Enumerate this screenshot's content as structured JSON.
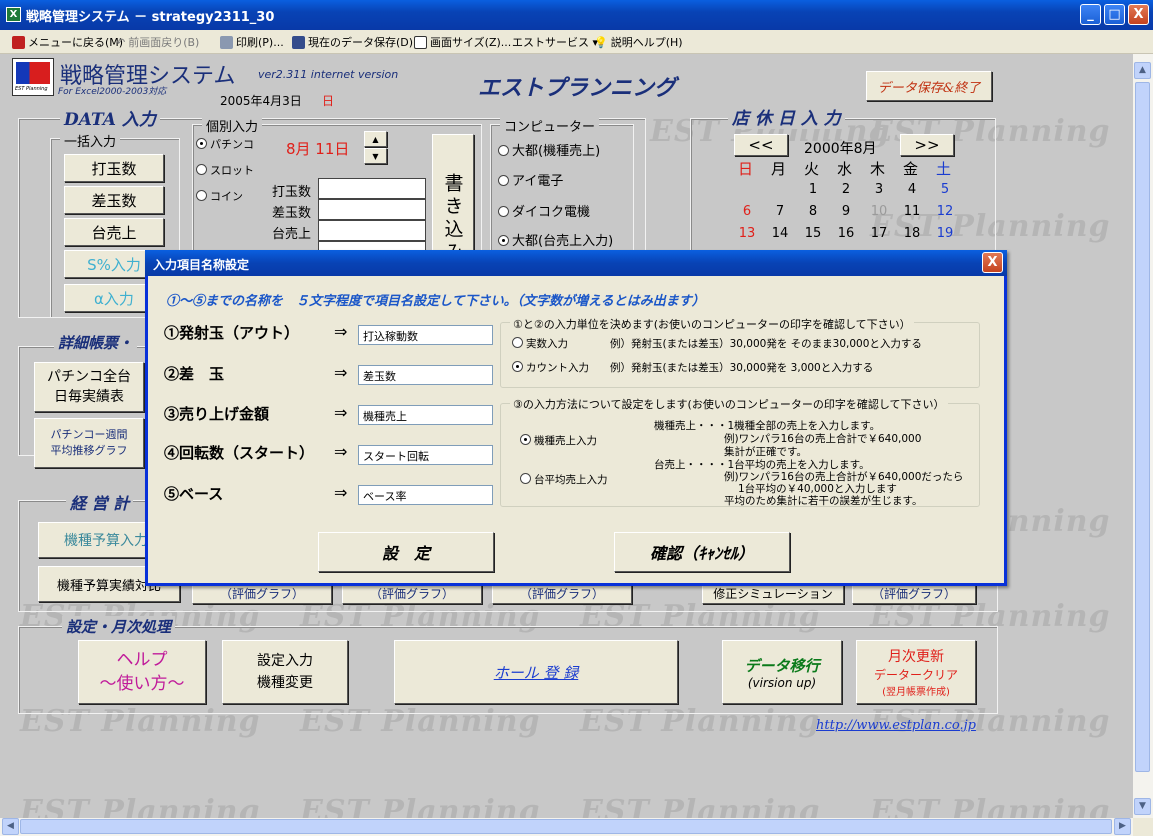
{
  "window": {
    "title": "戦略管理システム － strategy2311_30",
    "icon": "excel-icon",
    "min": "_",
    "max": "□",
    "close": "X"
  },
  "toolbar": {
    "items": [
      "メニューに戻る(M)",
      "前画面戻り(B)",
      "印刷(P)...",
      "現在のデータ保存(D)",
      "画面サイズ(Z)...",
      "エストサービス ▾",
      "説明ヘルプ(H)"
    ]
  },
  "header": {
    "system_title": "戦略管理システム",
    "version": "ver2.311 internet version",
    "excel_note": "For Excel2000-2003対応",
    "date": "2005年4月3日",
    "weekday": "日",
    "company": "エストプランニング",
    "save_exit": "データ保存&終了",
    "logo_text": "EST Planning"
  },
  "watermark": "EST Planning",
  "data_input": {
    "heading": "DATA 入力",
    "bulk_label": "一括入力",
    "bulk_buttons": [
      "打玉数",
      "差玉数",
      "台売上",
      "S%入力",
      "α入力"
    ],
    "indiv_label": "個別入力",
    "game_types": [
      "パチンコ",
      "スロット",
      "コイン"
    ],
    "selected_game": "パチンコ",
    "date_value": "8月 11日",
    "fields": [
      "打玉数",
      "差玉数",
      "台売上"
    ],
    "write_button": "書き込み",
    "computer_label": "コンピューター",
    "computers": [
      "大都(機種売上)",
      "アイ電子",
      "ダイコク電機",
      "大都(台売上入力)"
    ],
    "selected_computer": "大都(台売上入力)"
  },
  "holiday": {
    "heading": "店 休 日 入 力",
    "prev": "<<",
    "next": ">>",
    "month": "2000年8月",
    "weekdays": [
      "日",
      "月",
      "火",
      "水",
      "木",
      "金",
      "土"
    ],
    "rows": [
      [
        "",
        "",
        "1",
        "2",
        "3",
        "4",
        "5"
      ],
      [
        "6",
        "7",
        "8",
        "9",
        "10",
        "11",
        "12"
      ],
      [
        "13",
        "14",
        "15",
        "16",
        "17",
        "18",
        "19"
      ]
    ]
  },
  "detail": {
    "heading": "詳細帳票・",
    "btn1": "パチンコ全台\n日毎実績表",
    "btn2": "パチンコー週間\n平均推移グラフ"
  },
  "plan": {
    "heading": "経 営 計",
    "btn1": "機種予算入力",
    "btn2": "機種予算実績対比",
    "graph": "（評価グラフ）",
    "sim": "修正シミュレーション"
  },
  "settings": {
    "heading": "設定・月次処理",
    "help": "ヘルプ\n～使い方～",
    "setting": "設定入力\n機種変更",
    "hall": "ホール 登 録",
    "migrate": "データ移行",
    "migrate_sub": "(virsion up)",
    "monthly1": "月次更新",
    "monthly2": "データークリア",
    "monthly3": "(翌月帳票作成)",
    "url": "http://www.estplan.co.jp"
  },
  "dialog": {
    "title": "入力項目名称設定",
    "close": "X",
    "instruction": "①～⑤までの名称を　５文字程度で項目名設定して下さい。（文字数が増えるとはみ出ます）",
    "items": [
      {
        "label": "①発射玉（アウト）",
        "value": "打込稼動数"
      },
      {
        "label": "②差　玉",
        "value": "差玉数"
      },
      {
        "label": "③売り上げ金額",
        "value": "機種売上"
      },
      {
        "label": "④回転数（スタート）",
        "value": "スタート回転"
      },
      {
        "label": "⑤ベース",
        "value": "ベース率"
      }
    ],
    "arrow": "⇒",
    "unit_group": {
      "title": "①と②の入力単位を決めます(お使いのコンピューターの印字を確認して下さい）",
      "options": [
        {
          "label": "実数入力",
          "example": "例）発射玉(または差玉）30,000発を そのまま30,000と入力する",
          "selected": false
        },
        {
          "label": "カウント入力",
          "example": "例）発射玉(または差玉）30,000発を 3,000と入力する",
          "selected": true
        }
      ]
    },
    "method_group": {
      "title": "③の入力方法について設定をします(お使いのコンピューターの印字を確認して下さい）",
      "opt1": "機種売上入力",
      "opt2": "台平均売上入力",
      "desc1": [
        "機種売上・・・1機種全部の売上を入力します。",
        "例)ワンパラ16台の売上合計で￥640,000",
        "集計が正確です。"
      ],
      "desc2": [
        "台売上・・・・1台平均の売上を入力します。",
        "例)ワンパラ16台の売上合計が￥640,000だったら",
        "1台平均の￥40,000と入力します",
        "平均のため集計に若干の誤差が生じます。"
      ]
    },
    "ok": "設　定",
    "cancel": "確認（ｷｬﾝｾﾙ）"
  },
  "colors": {
    "titlebar": "#0843b5",
    "sheet": "#c8c8c8",
    "heading": "#1a2f7a",
    "red": "#e0201a",
    "sat_blue": "#1a3cd0"
  }
}
